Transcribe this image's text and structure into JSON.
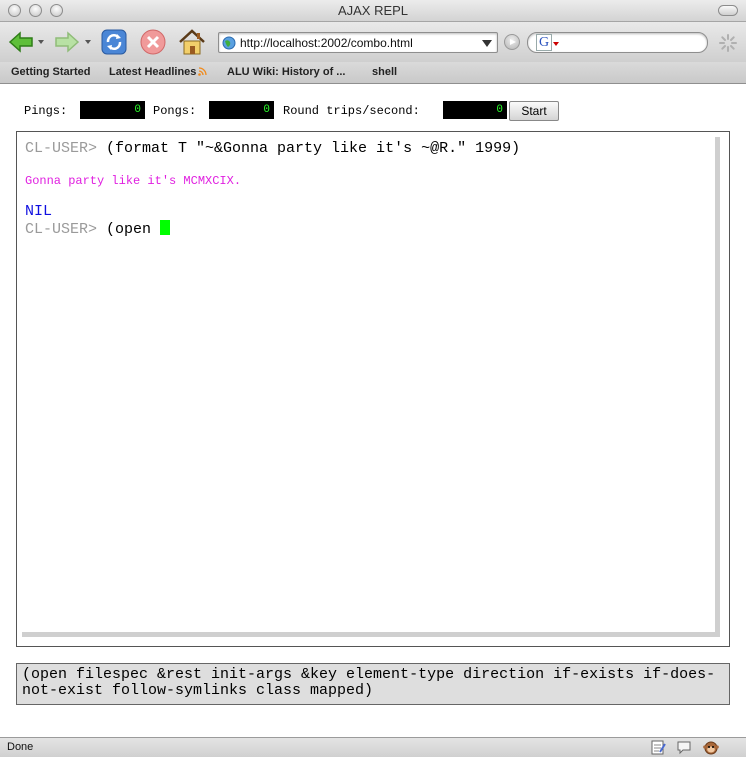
{
  "window": {
    "title": "AJAX REPL"
  },
  "toolbar": {
    "url": "http://localhost:2002/combo.html",
    "search_value": ""
  },
  "bookmarks": [
    {
      "label": "Getting Started"
    },
    {
      "label": "Latest Headlines"
    },
    {
      "label": "ALU Wiki: History of ..."
    },
    {
      "label": "shell"
    }
  ],
  "stats": {
    "pings_label": "Pings:",
    "pings_value": "0",
    "pongs_label": "Pongs:",
    "pongs_value": "0",
    "rate_label": "Round trips/second:",
    "rate_value": "0",
    "start_label": "Start"
  },
  "repl": {
    "prompt": "CL-USER>",
    "line1_code": " (format T \"~&Gonna party like it's ~@R.\" 1999)",
    "output": "Gonna party like it's MCMXCIX.",
    "result": "NIL",
    "line2_code": " (open "
  },
  "arglist": "(open filespec &rest init-args &key element-type direction if-exists if-does-not-exist follow-symlinks class mapped)",
  "status": {
    "text": "Done"
  },
  "colors": {
    "prompt": "#9a9a9a",
    "output": "#e020e0",
    "result": "#1010e0",
    "cursor": "#00ff00",
    "counter_text": "#2aff2a"
  }
}
